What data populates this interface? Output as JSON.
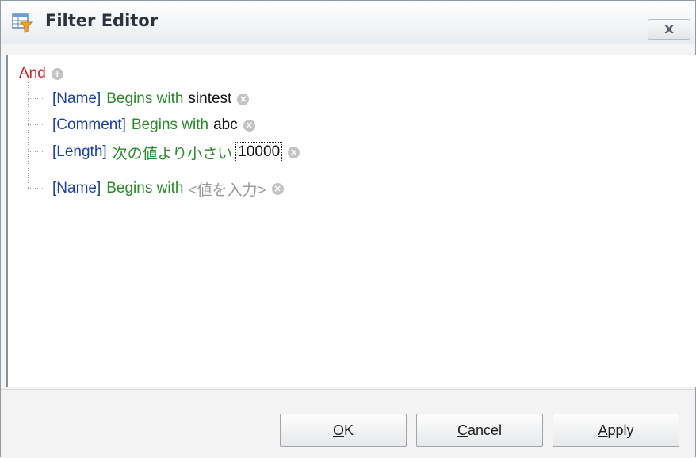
{
  "window": {
    "title": "Filter Editor",
    "close_label": "x"
  },
  "filter": {
    "group_operator": "And",
    "conditions": [
      {
        "field": "[Name]",
        "operator": "Begins with",
        "value": "sintest"
      },
      {
        "field": "[Comment]",
        "operator": "Begins with",
        "value": "abc"
      },
      {
        "field": "[Length]",
        "operator": "次の値より小さい",
        "value": "10000"
      },
      {
        "field": "[Name]",
        "operator": "Begins with",
        "value": "<値を入力>"
      }
    ]
  },
  "buttons": {
    "ok": {
      "mnemonic": "O",
      "rest": "K"
    },
    "cancel": {
      "mnemonic": "C",
      "rest": "ancel"
    },
    "apply": {
      "mnemonic": "A",
      "rest": "pply"
    }
  }
}
